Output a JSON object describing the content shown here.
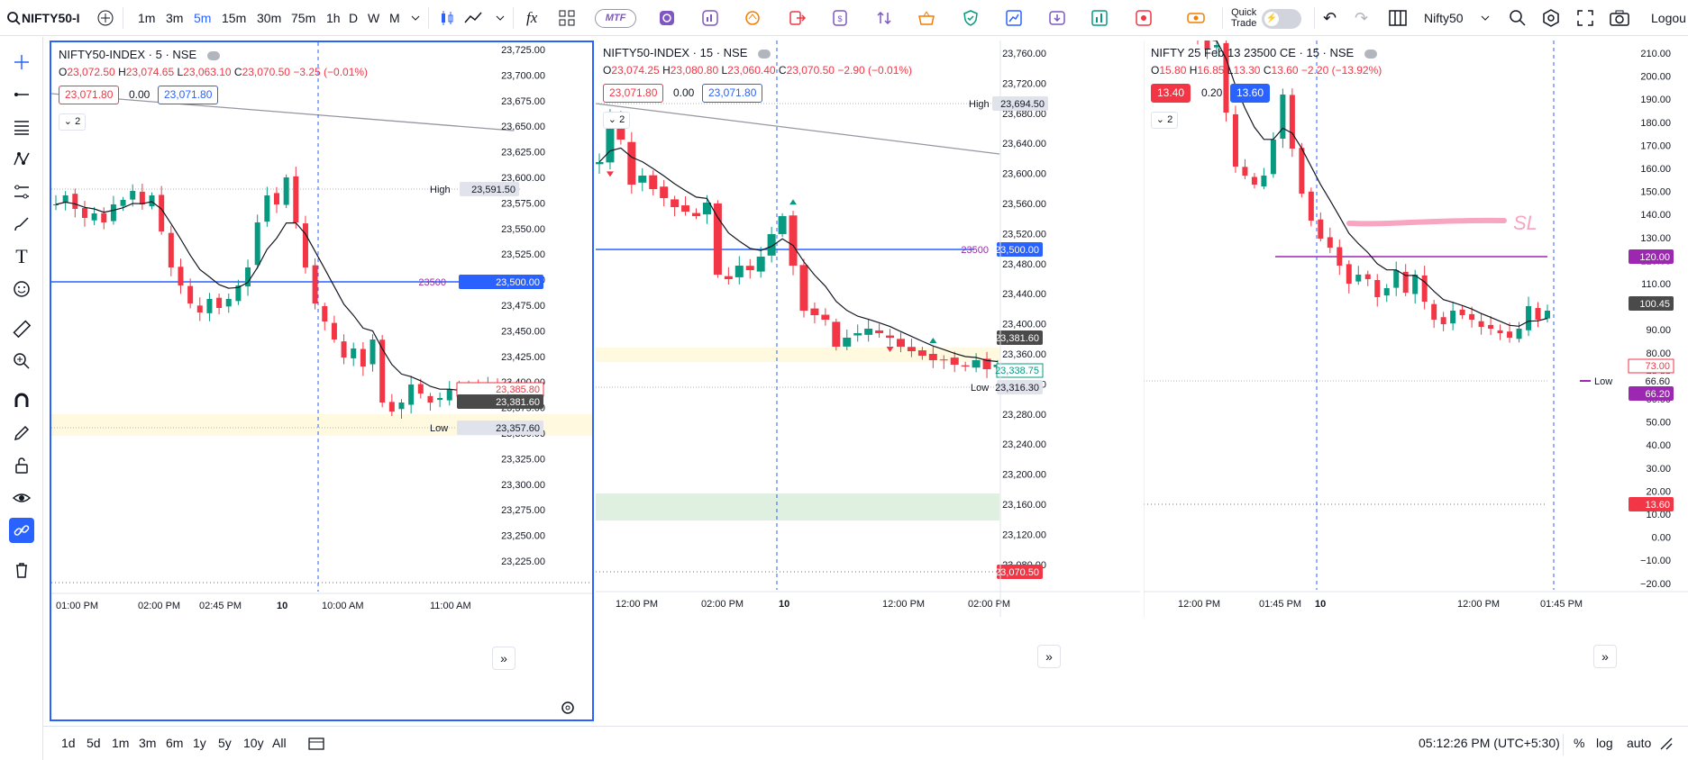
{
  "topbar": {
    "symbol": "NIFTY50-I",
    "intervals": [
      "1m",
      "3m",
      "5m",
      "15m",
      "30m",
      "75m",
      "1h",
      "D",
      "W",
      "M"
    ],
    "active_interval": "5m",
    "mtf": "MTF",
    "quick_trade": "Quick\nTrade",
    "layout_name": "Nifty50",
    "logout": "Logou"
  },
  "panes": [
    {
      "title": "NIFTY50-INDEX · 5 · NSE",
      "ohlc": {
        "o": "23,072.50",
        "h": "23,074.65",
        "l": "23,063.10",
        "c": "23,070.50",
        "chg": "−3.25 (−0.01%)"
      },
      "sell": "23,071.80",
      "spread": "0.00",
      "buy": "23,071.80",
      "collapse": "2",
      "ticks": [
        "23,725.00",
        "23,700.00",
        "23,675.00",
        "23,650.00",
        "23,625.00",
        "23,600.00",
        "23,575.00",
        "23,550.00",
        "23,525.00",
        "23,500.00",
        "23,475.00",
        "23,450.00",
        "23,425.00",
        "23,400.00",
        "23,375.00",
        "23,350.00",
        "23,325.00",
        "23,300.00",
        "23,275.00",
        "23,250.00",
        "23,225.00"
      ],
      "time": [
        "01:00 PM",
        "02:00 PM",
        "02:45 PM",
        "10",
        "10:00 AM",
        "11:00 AM"
      ],
      "labels": {
        "high": "High",
        "high_val": "23,591.50",
        "line_label": "23500",
        "line_val": "23,500.00",
        "alert_val": "23,385.80",
        "last_val": "23,381.60",
        "low": "Low",
        "low_val": "23,357.60"
      }
    },
    {
      "title": "NIFTY50-INDEX · 15 · NSE",
      "ohlc": {
        "o": "23,074.25",
        "h": "23,080.80",
        "l": "23,060.40",
        "c": "23,070.50",
        "chg": "−2.90 (−0.01%)"
      },
      "sell": "23,071.80",
      "spread": "0.00",
      "buy": "23,071.80",
      "collapse": "2",
      "ticks": [
        "23,760.00",
        "23,720.00",
        "23,680.00",
        "23,640.00",
        "23,600.00",
        "23,560.00",
        "23,520.00",
        "23,480.00",
        "23,440.00",
        "23,400.00",
        "23,360.00",
        "23,320.00",
        "23,280.00",
        "23,240.00",
        "23,200.00",
        "23,160.00",
        "23,120.00",
        "23,080.00"
      ],
      "time": [
        "12:00 PM",
        "02:00 PM",
        "10",
        "12:00 PM",
        "02:00 PM"
      ],
      "labels": {
        "high": "High",
        "high_val": "23,694.50",
        "line_label": "23500",
        "line_val": "23,500.00",
        "last_val": "23,381.60",
        "ema_val": "23,338.75",
        "low": "Low",
        "low_val": "23,316.30",
        "alert_val": "23,070.50"
      }
    },
    {
      "title": "NIFTY 25 Feb 13 23500 CE · 15 · NSE",
      "ohlc": {
        "o": "15.80",
        "h": "16.85",
        "l": "13.30",
        "c": "13.60",
        "chg": "−2.20 (−13.92%)"
      },
      "sell": "13.40",
      "spread": "0.20",
      "buy": "13.60",
      "collapse": "2",
      "ticks": [
        "210.00",
        "200.00",
        "190.00",
        "180.00",
        "170.00",
        "160.00",
        "150.00",
        "140.00",
        "130.00",
        "120.00",
        "110.00",
        "100.00",
        "90.00",
        "80.00",
        "70.00",
        "60.00",
        "50.00",
        "40.00",
        "30.00",
        "20.00",
        "10.00",
        "0.00",
        "−10.00",
        "−20.00"
      ],
      "time": [
        "12:00 PM",
        "01:45 PM",
        "10",
        "12:00 PM",
        "01:45 PM"
      ],
      "labels": {
        "line_val": "120.00",
        "last_val": "100.45",
        "alert_val": "73.00",
        "low": "Low",
        "low_val": "66.60",
        "low2_val": "66.20",
        "price_val": "13.60",
        "sl": "SL"
      }
    }
  ],
  "bottombar": {
    "ranges": [
      "1d",
      "5d",
      "1m",
      "3m",
      "6m",
      "1y",
      "5y",
      "10y",
      "All"
    ],
    "clock": "05:12:26 PM (UTC+5:30)",
    "pct": "%",
    "log": "log",
    "auto": "auto"
  },
  "colors": {
    "up": "#089981",
    "down": "#f23645",
    "accent": "#2962ff",
    "purple": "#9c27b0",
    "zone_yellow": "#fff9e0",
    "zone_green": "#dff0e0"
  }
}
